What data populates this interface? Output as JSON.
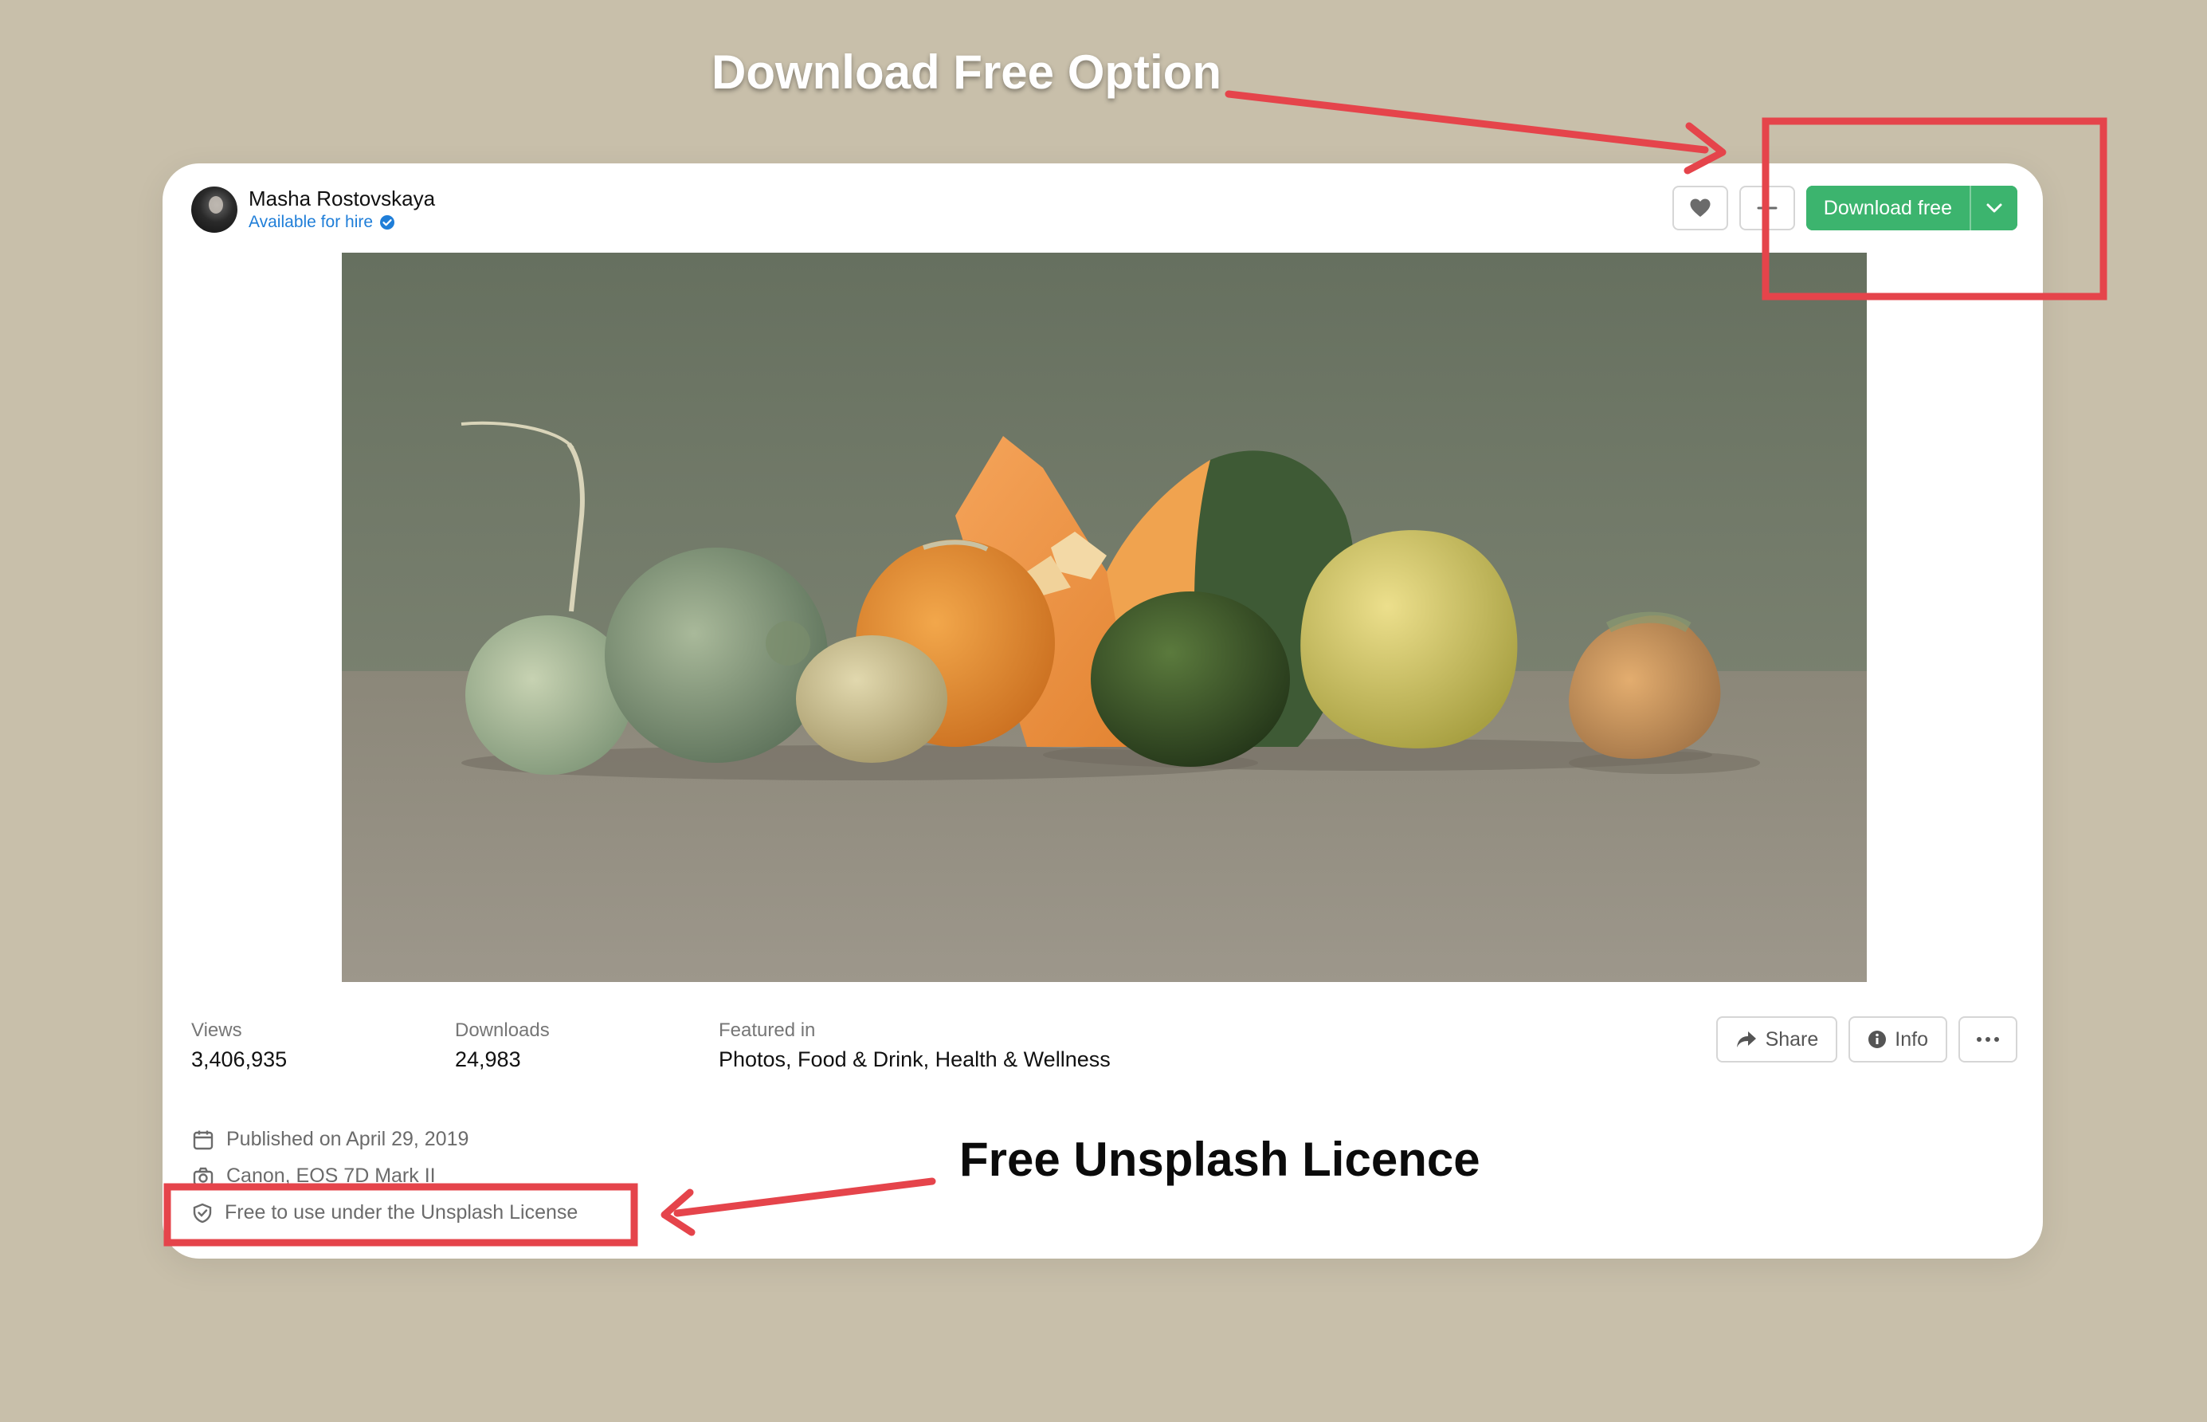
{
  "annotations": {
    "download_label": "Download Free Option",
    "license_label": "Free Unsplash Licence",
    "highlight_color": "#e5444b"
  },
  "author": {
    "name": "Masha Rostovskaya",
    "status": "Available for hire",
    "avatar_icon": "avatar"
  },
  "actions": {
    "like_icon": "heart-icon",
    "add_icon": "plus-icon",
    "download_label": "Download free",
    "download_menu_icon": "chevron-down-icon",
    "accent_color": "#3cb46e"
  },
  "photo": {
    "subject": "still-life-vegetables"
  },
  "stats": {
    "views_label": "Views",
    "views_value": "3,406,935",
    "downloads_label": "Downloads",
    "downloads_value": "24,983",
    "featured_label": "Featured in",
    "featured_value": "Photos, Food & Drink, Health & Wellness"
  },
  "secondary_actions": {
    "share_label": "Share",
    "info_label": "Info",
    "more_icon": "ellipsis-icon"
  },
  "meta": {
    "published": "Published on April 29, 2019",
    "camera": "Canon, EOS 7D Mark II",
    "license": "Free to use under the Unsplash License"
  }
}
